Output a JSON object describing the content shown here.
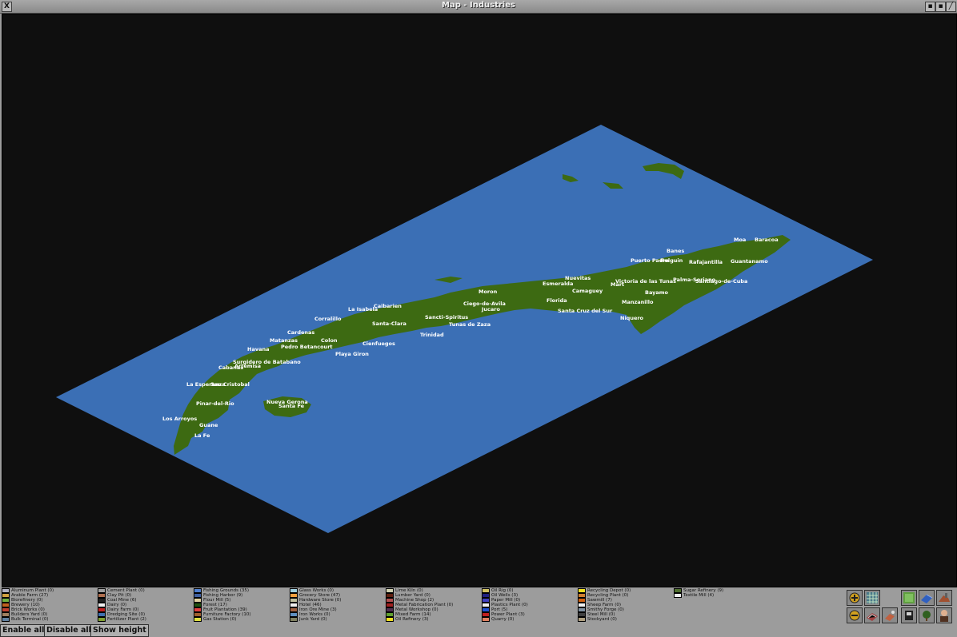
{
  "window": {
    "title": "Map - Industries",
    "close_glyph": "X",
    "min_glyph": "▪",
    "sticky_glyph": "▪",
    "shade_glyph": "╱"
  },
  "colors": {
    "water": "#3b6fb5",
    "land": "#3d6a12",
    "void": "#0f0f0f"
  },
  "towns": [
    "Moa",
    "Baracoa",
    "Banes",
    "Puerto Padre",
    "Guantanamo",
    "Holguin",
    "Rafajantilla",
    "Nuevitas",
    "Esmeralda",
    "Victoria de las Tunas",
    "Palma-Soriano",
    "Santiago-de-Cuba",
    "Mart",
    "Camaguey",
    "Bayamo",
    "Moron",
    "Caibarien",
    "La Isabela",
    "Ciego-de-Avila",
    "Jucaro",
    "Florida",
    "Manzanillo",
    "Corralillo",
    "Sancti-Spiritus",
    "Santa-Clara",
    "Tunas de Zaza",
    "Santa Cruz del Sur",
    "Niquero",
    "Cardenas",
    "Trinidad",
    "Matanzas",
    "Colon",
    "Pedro Betancourt",
    "Cienfuegos",
    "Havana",
    "Playa Giron",
    "Surgidero de Batabano",
    "Cabanas",
    "Artemisa",
    "La Esperanza",
    "San Cristobal",
    "Pinar-del-Rio",
    "Nueva Gerona",
    "Santa Fe",
    "Los Arroyos",
    "Guane",
    "La Fe"
  ],
  "legend": {
    "columns": [
      [
        {
          "label": "Aluminum Plant (0)",
          "color": "#b0b0c0"
        },
        {
          "label": "Arable Farm (27)",
          "color": "#d0a040"
        },
        {
          "label": "Biorefinery (0)",
          "color": "#70b040"
        },
        {
          "label": "Brewery (10)",
          "color": "#c06020"
        },
        {
          "label": "Brick Works (0)",
          "color": "#c04030"
        },
        {
          "label": "Builders Yard (0)",
          "color": "#a08060"
        },
        {
          "label": "Bulk Terminal (0)",
          "color": "#6080a0"
        }
      ],
      [
        {
          "label": "Cement Plant (0)",
          "color": "#a0a0a0"
        },
        {
          "label": "Clay Pit (0)",
          "color": "#b07050"
        },
        {
          "label": "Coal Mine (6)",
          "color": "#202020"
        },
        {
          "label": "Dairy (0)",
          "color": "#f0f0f0"
        },
        {
          "label": "Dairy Farm (0)",
          "color": "#c02020"
        },
        {
          "label": "Dredging Site (0)",
          "color": "#4070b0"
        },
        {
          "label": "Fertilizer Plant (2)",
          "color": "#80a030"
        }
      ],
      [
        {
          "label": "Fishing Grounds (35)",
          "color": "#5080d0"
        },
        {
          "label": "Fishing Harbor (9)",
          "color": "#4060a0"
        },
        {
          "label": "Flour Mill (5)",
          "color": "#e0d0a0"
        },
        {
          "label": "Forest (17)",
          "color": "#205010"
        },
        {
          "label": "Fruit Plantation (39)",
          "color": "#e04040"
        },
        {
          "label": "Furniture Factory (10)",
          "color": "#a06030"
        },
        {
          "label": "Gas Station (0)",
          "color": "#e0e040"
        }
      ],
      [
        {
          "label": "Glass Works (0)",
          "color": "#a0d0e0"
        },
        {
          "label": "Grocery Store (47)",
          "color": "#f0a040"
        },
        {
          "label": "Hardware Store (0)",
          "color": "#c0c0a0"
        },
        {
          "label": "Hotel (46)",
          "color": "#f0f0f0"
        },
        {
          "label": "Iron Ore Mine (3)",
          "color": "#a06040"
        },
        {
          "label": "Iron Works (0)",
          "color": "#6090c0"
        },
        {
          "label": "Junk Yard (0)",
          "color": "#808060"
        }
      ],
      [
        {
          "label": "Lime Kiln (0)",
          "color": "#d0d0b0"
        },
        {
          "label": "Lumber Yard (0)",
          "color": "#602010"
        },
        {
          "label": "Machine Shop (2)",
          "color": "#b05050"
        },
        {
          "label": "Metal Fabrication Plant (0)",
          "color": "#a02020"
        },
        {
          "label": "Metal Workshop (0)",
          "color": "#503050"
        },
        {
          "label": "Mixed Farm (14)",
          "color": "#60a030"
        },
        {
          "label": "Oil Refinery (3)",
          "color": "#f0e020"
        }
      ],
      [
        {
          "label": "Oil Rig (0)",
          "color": "#d0c060"
        },
        {
          "label": "Oil Wells (3)",
          "color": "#202080"
        },
        {
          "label": "Paper Mill (0)",
          "color": "#4040c0"
        },
        {
          "label": "Plastics Plant (0)",
          "color": "#f0f0f0"
        },
        {
          "label": "Port (5)",
          "color": "#2050d0"
        },
        {
          "label": "Power Plant (3)",
          "color": "#c02020"
        },
        {
          "label": "Quarry (0)",
          "color": "#e08060"
        }
      ],
      [
        {
          "label": "Recycling Depot (0)",
          "color": "#f0e020"
        },
        {
          "label": "Recycling Plant (0)",
          "color": "#d08030"
        },
        {
          "label": "Sawmill (7)",
          "color": "#d06010"
        },
        {
          "label": "Sheep Farm (0)",
          "color": "#f0f0f0"
        },
        {
          "label": "Smithy Forge (0)",
          "color": "#8090a0"
        },
        {
          "label": "Steel Mill (0)",
          "color": "#404040"
        },
        {
          "label": "Stockyard (0)",
          "color": "#b0a080"
        }
      ],
      [
        {
          "label": "Sugar Refinery (9)",
          "color": "#507030"
        },
        {
          "label": "Textile Mill (4)",
          "color": "#f0f0f0"
        }
      ]
    ]
  },
  "buttons": {
    "enable_all": "Enable all",
    "disable_all": "Disable all",
    "show_height": "Show height"
  },
  "icon_buttons": [
    "zoom-in-icon",
    "grid-icon",
    "contours-icon",
    "vehicles-icon",
    "industries-icon",
    "zoom-out-icon",
    "routes-icon",
    "trains-icon",
    "transport-icon",
    "vegetation-icon",
    "owners-icon"
  ]
}
